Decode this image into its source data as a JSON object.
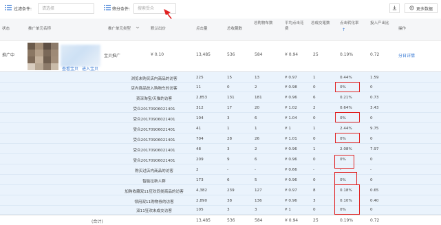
{
  "toolbar": {
    "filter_label": "过滤条件:",
    "filter_placeholder": "请选择",
    "sort_label": "筛分条件:",
    "sort_placeholder": "搜索受众",
    "more_label": "更多数据"
  },
  "columns": {
    "status": "状态",
    "unit_name": "推广单元名称",
    "promo_type": "推广单元类型",
    "default_bid": "默认出价",
    "impressions": "点击量",
    "collections": "总收藏数",
    "total_cart": "总购物车数",
    "avg_cost_1": "平均点击花",
    "avg_cost_2": "费",
    "total_deals": "总成交笔数",
    "cvr": "点击转化率",
    "roi": "投入产出比",
    "action": "操作"
  },
  "main_row": {
    "status": "推广中",
    "type": "宝贝推广",
    "bid": "¥ 0.10",
    "impressions": "13,485",
    "collections": "536",
    "cart": "584",
    "avg_cost": "¥ 0.94",
    "deals": "25",
    "cvr": "0.19%",
    "roi": "0.72",
    "action": "分日详情",
    "link_view": "查看宝贝",
    "link_enter": "进入宝贝"
  },
  "sub_rows": [
    {
      "name": "浏览未购买店内商品的访客",
      "impressions": "225",
      "collections": "15",
      "cart": "13",
      "avg_cost": "¥ 0.97",
      "deals": "1",
      "cvr": "0.44%",
      "roi": "1.59"
    },
    {
      "name": "店内商品放入购物车的访客",
      "impressions": "11",
      "collections": "0",
      "cart": "2",
      "avg_cost": "¥ 0.98",
      "deals": "0",
      "cvr": "0%",
      "roi": "0"
    },
    {
      "name": "资深淘宝/天猫的访客",
      "impressions": "2,853",
      "collections": "131",
      "cart": "181",
      "avg_cost": "¥ 0.96",
      "deals": "6",
      "cvr": "0.21%",
      "roi": "0.73"
    },
    {
      "name": "受众20170906021401",
      "impressions": "312",
      "collections": "17",
      "cart": "20",
      "avg_cost": "¥ 1.02",
      "deals": "2",
      "cvr": "0.64%",
      "roi": "3.43"
    },
    {
      "name": "受众20170906021401",
      "impressions": "104",
      "collections": "3",
      "cart": "6",
      "avg_cost": "¥ 1.04",
      "deals": "0",
      "cvr": "0%",
      "roi": "0"
    },
    {
      "name": "受众20170906021401",
      "impressions": "41",
      "collections": "1",
      "cart": "1",
      "avg_cost": "¥ 1",
      "deals": "1",
      "cvr": "2.44%",
      "roi": "9.75"
    },
    {
      "name": "受众20170906021401",
      "impressions": "704",
      "collections": "28",
      "cart": "26",
      "avg_cost": "¥ 1.01",
      "deals": "0",
      "cvr": "0%",
      "roi": "0"
    },
    {
      "name": "受众20170906021401",
      "impressions": "48",
      "collections": "3",
      "cart": "2",
      "avg_cost": "¥ 0.96",
      "deals": "1",
      "cvr": "2.08%",
      "roi": "7.97"
    },
    {
      "name": "受众20170906021401",
      "impressions": "209",
      "collections": "9",
      "cart": "6",
      "avg_cost": "¥ 0.96",
      "deals": "0",
      "cvr": "0%",
      "roi": "0"
    },
    {
      "name": "购买过店内商品的访客",
      "impressions": "2",
      "collections": "-",
      "cart": "-",
      "avg_cost": "¥ 0.66",
      "deals": "-",
      "cvr": "-",
      "roi": "-"
    },
    {
      "name": "智能拉新人群",
      "impressions": "173",
      "collections": "6",
      "cart": "5",
      "avg_cost": "¥ 0.96",
      "deals": "0",
      "cvr": "0%",
      "roi": "0"
    },
    {
      "name": "加购收藏双11狂欢同类商品的访客",
      "impressions": "4,382",
      "collections": "239",
      "cart": "127",
      "avg_cost": "¥ 0.97",
      "deals": "8",
      "cvr": "0.18%",
      "roi": "0.65"
    },
    {
      "name": "领用双11购物劵的访客",
      "impressions": "2,890",
      "collections": "38",
      "cart": "136",
      "avg_cost": "¥ 0.96",
      "deals": "3",
      "cvr": "0.10%",
      "roi": "0.40"
    },
    {
      "name": "双11狂欢未成交访客",
      "impressions": "105",
      "collections": "3",
      "cart": "3",
      "avg_cost": "¥ 1",
      "deals": "0",
      "cvr": "0%",
      "roi": "0"
    }
  ],
  "total_row": {
    "label": "(合计)",
    "impressions": "13,485",
    "collections": "536",
    "cart": "584",
    "avg_cost": "¥ 0.94",
    "deals": "25",
    "cvr": "0.19%",
    "roi": "0.72"
  },
  "colors": {
    "accent": "#3a7bd5",
    "highlight": "#e02020",
    "sub_bg": "#eaf3fc"
  }
}
